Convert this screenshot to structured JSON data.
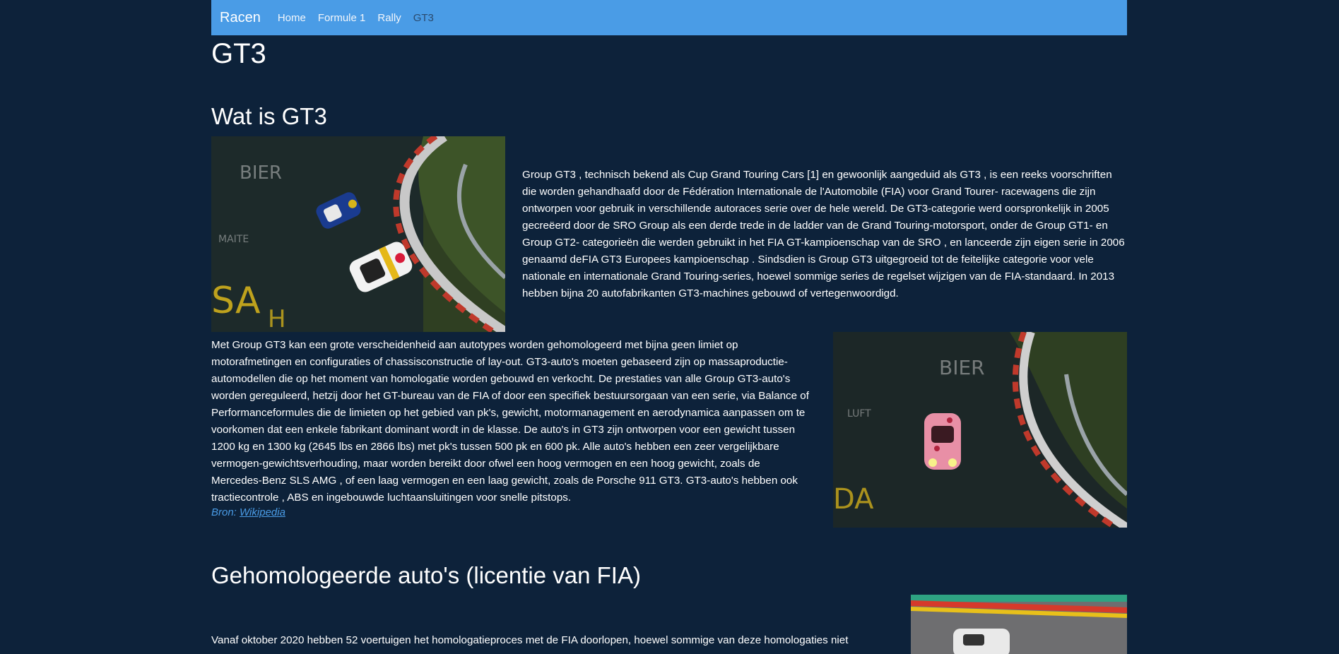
{
  "nav": {
    "brand": "Racen",
    "links": [
      "Home",
      "Formule 1",
      "Rally",
      "GT3"
    ]
  },
  "page": {
    "title": "GT3"
  },
  "section1": {
    "heading": "Wat is GT3",
    "paragraph1": "Group GT3 , technisch bekend als Cup Grand Touring Cars [1] en gewoonlijk aangeduid als GT3 , is een reeks voorschriften die worden gehandhaafd door de Fédération Internationale de l'Automobile (FIA) voor Grand Tourer- racewagens die zijn ontworpen voor gebruik in verschillende autoraces serie over de hele wereld. De GT3-categorie werd oorspronkelijk in 2005 gecreëerd door de SRO Group als een derde trede in de ladder van de Grand Touring-motorsport, onder de Group GT1- en Group GT2- categorieën die werden gebruikt in het FIA GT-kampioenschap van de SRO , en lanceerde zijn eigen serie in 2006 genaamd deFIA GT3 Europees kampioenschap . Sindsdien is Group GT3 uitgegroeid tot de feitelijke categorie voor vele nationale en internationale Grand Touring-series, hoewel sommige series de regelset wijzigen van de FIA-standaard. In 2013 hebben bijna 20 autofabrikanten GT3-machines gebouwd of vertegenwoordigd.",
    "paragraph2": "Met Group GT3 kan een grote verscheidenheid aan autotypes worden gehomologeerd met bijna geen limiet op motorafmetingen en configuraties of chassisconstructie of lay-out. GT3-auto's moeten gebaseerd zijn op massaproductie-automodellen die op het moment van homologatie worden gebouwd en verkocht. De prestaties van alle Group GT3-auto's worden gereguleerd, hetzij door het GT-bureau van de FIA of door een specifiek bestuursorgaan van een serie, via Balance of Performanceformules die de limieten op het gebied van pk's, gewicht, motormanagement en aerodynamica aanpassen om te voorkomen dat een enkele fabrikant dominant wordt in de klasse. De auto's in GT3 zijn ontworpen voor een gewicht tussen 1200 kg en 1300 kg (2645 lbs en 2866 lbs) met pk's tussen 500 pk en 600 pk. Alle auto's hebben een zeer vergelijkbare vermogen-gewichtsverhouding, maar worden bereikt door ofwel een hoog vermogen en een hoog gewicht, zoals de Mercedes-Benz SLS AMG , of een laag vermogen en een laag gewicht, zoals de Porsche 911 GT3. GT3-auto's hebben ook tractiecontrole , ABS en ingebouwde luchtaansluitingen voor snelle pitstops.",
    "source_prefix": "Bron:",
    "source_link": "Wikipedia"
  },
  "section2": {
    "heading": "Gehomologeerde auto's (licentie van FIA)",
    "paragraph": "Vanaf oktober 2020 hebben 52 voertuigen het homologatieproces met de FIA doorlopen, hoewel sommige van deze homologaties niet"
  },
  "colors": {
    "background": "#0d223a",
    "navbar": "#4a9ce6",
    "link": "#4a9ce6"
  }
}
